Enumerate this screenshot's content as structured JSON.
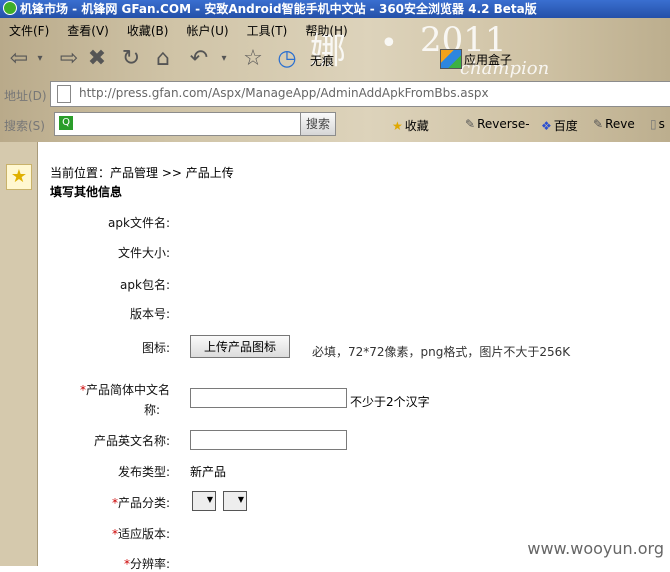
{
  "window": {
    "title": "机锋市场 - 机锋网 GFan.COM - 安致Android智能手机中文站 - 360安全浏览器 4.2 Beta版"
  },
  "menu": [
    "文件(F)",
    "查看(V)",
    "收藏(B)",
    "帐户(U)",
    "工具(T)",
    "帮助(H)"
  ],
  "skin": {
    "na": "娜",
    "dot": "•",
    "year": "2011",
    "champion": "champion"
  },
  "toolbar": {
    "mode_label": "无痕",
    "app_box_label": "应用盒子"
  },
  "address": {
    "label": "地址(D)",
    "url": "http://press.gfan.com/Aspx/ManageApp/AdminAddApkFromBbs.aspx"
  },
  "search": {
    "label": "搜索(S)",
    "button": "搜索"
  },
  "favorites": [
    {
      "icon": "star-icon",
      "label": "收藏"
    },
    {
      "icon": "bookmark-icon",
      "label": "Reverse-"
    },
    {
      "icon": "baidu-icon",
      "label": "百度"
    },
    {
      "icon": "bookmark-icon",
      "label": "Reve"
    },
    {
      "icon": "page-icon",
      "label": "s"
    }
  ],
  "page": {
    "breadcrumb": "当前位置：产品管理 >> 产品上传",
    "section_title": "填写其他信息",
    "fields": {
      "apk_filename": "apk文件名:",
      "file_size": "文件大小:",
      "apk_package": "apk包名:",
      "version": "版本号:",
      "icon": "图标:",
      "cn_name_line1": "产品简体中文名",
      "cn_name_line2": "称:",
      "en_name": "产品英文名称:",
      "release_type": "发布类型:",
      "category": "产品分类:",
      "compat_version": "适应版本:",
      "resolution": "分辨率:"
    },
    "upload_button": "上传产品图标",
    "upload_hint": "必填，72*72像素，png格式，图片不大于256K",
    "cn_name_hint": "不少于2个汉字",
    "release_type_value": "新产品",
    "required_mark": "*"
  },
  "watermark": "www.wooyun.org"
}
